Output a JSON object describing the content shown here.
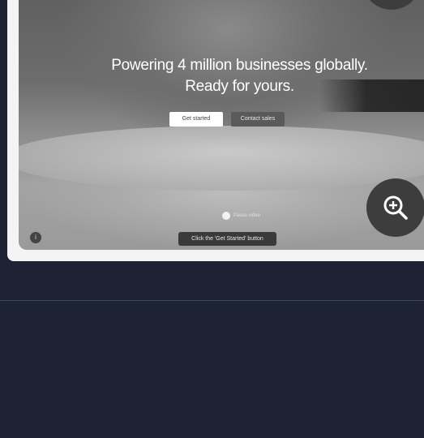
{
  "hero": {
    "headline_line1": "Powering 4 million businesses globally.",
    "headline_line2": "Ready for yours.",
    "primary_button": "Get started",
    "secondary_button": "Contact sales",
    "pause_label": "Pause video"
  },
  "tooltip": "Click the 'Get Started' button",
  "info_label": "i",
  "colors": {
    "background": "#1e2235",
    "card": "#f4f4f4",
    "zoom_button": "#3d3d3d"
  },
  "icons": {
    "zoom": "zoom-in-icon",
    "info": "info-icon",
    "pause": "pause-icon"
  }
}
